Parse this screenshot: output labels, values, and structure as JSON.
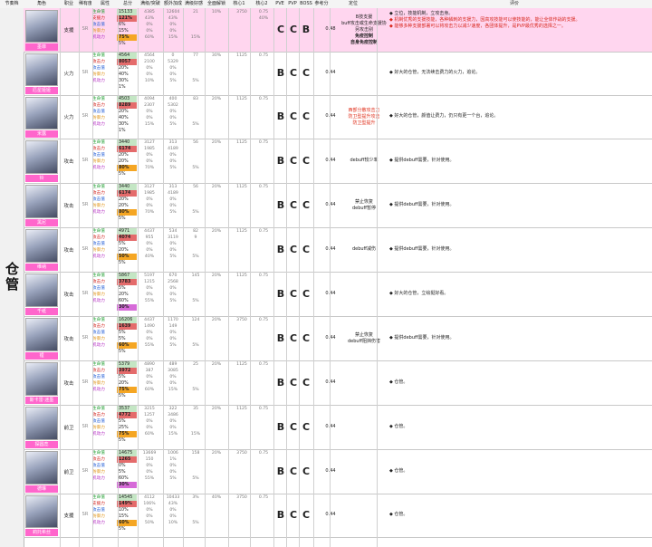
{
  "headers": [
    "节奏档",
    "角色",
    "职业",
    "稀有度",
    "属性",
    "总分",
    "满级/突破",
    "额外加成",
    "满级好感",
    "全面解锁",
    "核心1",
    "核心2",
    "PVE",
    "PVP",
    "BOSS",
    "参考分",
    "定位",
    "评价"
  ],
  "section_label": "仓管",
  "stat_labels": [
    [
      "生命值",
      "支援力",
      "攻击值",
      "防御力",
      "机动力"
    ],
    [
      "生命值",
      "攻击力",
      "攻击值",
      "防御力",
      "机动力"
    ],
    [
      "生命值",
      "攻击力",
      "攻击值",
      "防御力",
      "机动力"
    ],
    [
      "生命值",
      "攻击力",
      "攻击值",
      "防御力",
      "机动力"
    ],
    [
      "生命值",
      "攻击力",
      "攻击值",
      "防御力",
      "机动力"
    ],
    [
      "生命值",
      "攻击力",
      "攻击值",
      "防御力",
      "机动力"
    ],
    [
      "生命值",
      "攻击力",
      "攻击值",
      "防御力",
      "机动力"
    ],
    [
      "生命值",
      "攻击力",
      "攻击值",
      "防御力",
      "机动力"
    ],
    [
      "生命值",
      "攻击力",
      "攻击值",
      "防御力",
      "机动力"
    ],
    [
      "生命值",
      "攻击力",
      "攻击值",
      "防御力",
      "机动力"
    ],
    [
      "生命值",
      "攻击力",
      "攻击值",
      "防御力",
      "机动力"
    ],
    [
      "生命值",
      "支援力",
      "攻击值",
      "防御力",
      "机动力"
    ]
  ],
  "rows": [
    {
      "name": "墨菲",
      "role": "支援",
      "rarity": "SR",
      "totals": [
        "15133",
        "121%",
        "6%",
        "15%",
        "75%",
        "5%"
      ],
      "hl": 4,
      "c1": [
        "4385",
        "43%",
        "0%",
        "0%",
        "60%"
      ],
      "c2": [
        "12604",
        "43%",
        "0%",
        "0%",
        "15%"
      ],
      "c3": [
        "21",
        "",
        "",
        "",
        "15%"
      ],
      "c4": [
        "10%",
        "",
        "",
        "",
        ""
      ],
      "c5": [
        "3750",
        "",
        "",
        "",
        ""
      ],
      "c6": [
        "0.75",
        "40%",
        "",
        "",
        ""
      ],
      "pve": "C",
      "pvp": "C",
      "boss": "B",
      "ref": "0.48",
      "pos": [
        "B技支援",
        "buff攻击或生命支援协",
        "另攻击别",
        "免疫控制",
        "自身免疫控制"
      ],
      "pos_red": false,
      "eval": [
        "◆ 立位，技能机制，立攻击身。",
        "◆ 机制优秀的支援技能，各种鳞刺的支援力，因高攻技能可以使技能的，能让全体作战的支援。",
        "◆ 能够多种支援部署可以将攻击力以减少速度，各团体提升，是PVP最优秀的选择之一。"
      ],
      "pink": true
    },
    {
      "name": "厄星娅娅",
      "role": "火力",
      "rarity": "SR",
      "totals": [
        "4564",
        "8057",
        "20%",
        "40%",
        "30%",
        "1%"
      ],
      "hl": 1,
      "c1": [
        "4564",
        "2100",
        "0%",
        "0%",
        "10%"
      ],
      "c2": [
        "0",
        "5329",
        "0%",
        "0%",
        "5%"
      ],
      "c3": [
        "77",
        "",
        "",
        "",
        "5%"
      ],
      "c4": [
        "30%",
        "",
        "",
        "",
        ""
      ],
      "c5": [
        "1125",
        "",
        "",
        "",
        ""
      ],
      "c6": [
        "0.75",
        "",
        "",
        "",
        ""
      ],
      "pve": "B",
      "pvp": "C",
      "boss": "C",
      "ref": "0.44",
      "pos": [],
      "pos_red": false,
      "eval": [
        "◆ 好大的仓管，无法续击费力的火力，追论。"
      ],
      "pink": false
    },
    {
      "name": "米露",
      "role": "火力",
      "rarity": "SR",
      "totals": [
        "4503",
        "8289",
        "20%",
        "40%",
        "30%",
        "1%"
      ],
      "hl": 1,
      "c1": [
        "4094",
        "2307",
        "0%",
        "0%",
        "15%"
      ],
      "c2": [
        "400",
        "5302",
        "0%",
        "0%",
        "5%"
      ],
      "c3": [
        "83",
        "",
        "",
        "",
        "5%"
      ],
      "c4": [
        "20%",
        "",
        "",
        "",
        ""
      ],
      "c5": [
        "1125",
        "",
        "",
        "",
        ""
      ],
      "c6": [
        "0.75",
        "",
        "",
        "",
        ""
      ],
      "pve": "B",
      "pvp": "C",
      "boss": "C",
      "ref": "0.44",
      "pos": [
        "西部分散攻击力",
        "防卫型提升攻击",
        "防卫型提升"
      ],
      "pos_red": true,
      "eval": [
        "◆ 好大的仓管，颜值让费力，仍只有更一个台，追论。"
      ],
      "pink": false
    },
    {
      "name": "铃",
      "role": "攻击",
      "rarity": "SR",
      "totals": [
        "3440",
        "6174",
        "20%",
        "20%",
        "80%",
        "5%"
      ],
      "hl": 4,
      "c1": [
        "3127",
        "1985",
        "0%",
        "0%",
        "70%"
      ],
      "c2": [
        "313",
        "4189",
        "0%",
        "0%",
        "5%"
      ],
      "c3": [
        "56",
        "",
        "",
        "",
        "5%"
      ],
      "c4": [
        "20%",
        "",
        "",
        "",
        ""
      ],
      "c5": [
        "1125",
        "",
        "",
        "",
        ""
      ],
      "c6": [
        "0.75",
        "",
        "",
        "",
        ""
      ],
      "pve": "B",
      "pvp": "C",
      "boss": "C",
      "ref": "0.44",
      "pos": [
        "debuff较少率"
      ],
      "pos_red": false,
      "eval": [
        "◆ 提供debuff需要，针对使用。"
      ],
      "pink": false
    },
    {
      "name": "黑尼",
      "role": "攻击",
      "rarity": "SR",
      "totals": [
        "3440",
        "6174",
        "20%",
        "20%",
        "80%",
        "5%"
      ],
      "hl": 4,
      "c1": [
        "3127",
        "1985",
        "0%",
        "0%",
        "70%"
      ],
      "c2": [
        "313",
        "4189",
        "0%",
        "0%",
        "5%"
      ],
      "c3": [
        "56",
        "",
        "",
        "",
        "5%"
      ],
      "c4": [
        "20%",
        "",
        "",
        "",
        ""
      ],
      "c5": [
        "1125",
        "",
        "",
        "",
        ""
      ],
      "c6": [
        "0.75",
        "",
        "",
        "",
        ""
      ],
      "pve": "B",
      "pvp": "C",
      "boss": "C",
      "ref": "0.44",
      "pos": [
        "禁止恢复",
        "debuff暂停"
      ],
      "pos_red": false,
      "eval": [
        "◆ 提供debuff需要，针对使用。"
      ],
      "pink": false
    },
    {
      "name": "维纳",
      "role": "攻击",
      "rarity": "SR",
      "totals": [
        "4971",
        "4074",
        "5%",
        "20%",
        "50%",
        "5%"
      ],
      "hl": 4,
      "c1": [
        "4437",
        "955",
        "0%",
        "0%",
        "40%"
      ],
      "c2": [
        "534",
        "3119",
        "0%",
        "0%",
        "5%"
      ],
      "c3": [
        "82",
        "9",
        "",
        "",
        "5%"
      ],
      "c4": [
        "20%",
        "",
        "",
        "",
        ""
      ],
      "c5": [
        "1125",
        "",
        "",
        "",
        ""
      ],
      "c6": [
        "0.75",
        "",
        "",
        "",
        ""
      ],
      "pve": "B",
      "pvp": "C",
      "boss": "C",
      "ref": "0.44",
      "pos": [
        "debuff减伤"
      ],
      "pos_red": false,
      "eval": [
        "◆ 提供debuff需要，针对使用。"
      ],
      "pink": false
    },
    {
      "name": "千纸",
      "role": "攻击",
      "rarity": "SR",
      "totals": [
        "5867",
        "3783",
        "5%",
        "20%",
        "60%",
        "30%"
      ],
      "hl": 5,
      "c1": [
        "5197",
        "1215",
        "0%",
        "0%",
        "55%"
      ],
      "c2": [
        "670",
        "2568",
        "0%",
        "0%",
        "5%"
      ],
      "c3": [
        "145",
        "",
        "",
        "",
        "5%"
      ],
      "c4": [
        "20%",
        "",
        "",
        "",
        ""
      ],
      "c5": [
        "1125",
        "",
        "",
        "",
        ""
      ],
      "c6": [
        "0.75",
        "",
        "",
        "",
        ""
      ],
      "pve": "B",
      "pvp": "C",
      "boss": "C",
      "ref": "0.44",
      "pos": [],
      "pos_red": false,
      "eval": [
        "◆ 好大的仓管，立绘挺好看。"
      ],
      "pink": false
    },
    {
      "name": "锂",
      "role": "攻击",
      "rarity": "SR",
      "totals": [
        "16206",
        "1639",
        "5%",
        "5%",
        "60%",
        "5%"
      ],
      "hl": 4,
      "c1": [
        "4437",
        "1490",
        "0%",
        "0%",
        "55%"
      ],
      "c2": [
        "1170",
        "149",
        "0%",
        "0%",
        "5%"
      ],
      "c3": [
        "124",
        "",
        "",
        "",
        "5%"
      ],
      "c4": [
        "20%",
        "",
        "",
        "",
        ""
      ],
      "c5": [
        "3750",
        "",
        "",
        "",
        ""
      ],
      "c6": [
        "0.75",
        "",
        "",
        "",
        ""
      ],
      "pve": "B",
      "pvp": "C",
      "boss": "C",
      "ref": "0.44",
      "pos": [
        "禁止恢复",
        "debuff阻挡伤害"
      ],
      "pos_red": false,
      "eval": [
        "◆ 提供debuff需要，针对使用。"
      ],
      "pink": false
    },
    {
      "name": "斯卡雷·迷墨",
      "role": "攻击",
      "rarity": "SR",
      "totals": [
        "5379",
        "3972",
        "5%",
        "20%",
        "75%",
        "5%"
      ],
      "hl": 4,
      "c1": [
        "4890",
        "387",
        "0%",
        "0%",
        "60%"
      ],
      "c2": [
        "489",
        "3085",
        "0%",
        "0%",
        "15%"
      ],
      "c3": [
        "25",
        "",
        "",
        "",
        "5%"
      ],
      "c4": [
        "20%",
        "",
        "",
        "",
        ""
      ],
      "c5": [
        "1125",
        "",
        "",
        "",
        ""
      ],
      "c6": [
        "0.75",
        "",
        "",
        "",
        ""
      ],
      "pve": "B",
      "pvp": "C",
      "boss": "C",
      "ref": "0.44",
      "pos": [],
      "pos_red": false,
      "eval": [
        "◆ 仓管。"
      ],
      "pink": false
    },
    {
      "name": "探圆蕊",
      "role": "前卫",
      "rarity": "SR",
      "totals": [
        "3537",
        "4772",
        "5%",
        "25%",
        "75%",
        "5%"
      ],
      "hl": 4,
      "c1": [
        "3215",
        "1257",
        "0%",
        "0%",
        "60%"
      ],
      "c2": [
        "322",
        "3486",
        "0%",
        "0%",
        "15%"
      ],
      "c3": [
        "35",
        "",
        "",
        "",
        "15%"
      ],
      "c4": [
        "20%",
        "",
        "",
        "",
        ""
      ],
      "c5": [
        "1125",
        "",
        "",
        "",
        ""
      ],
      "c6": [
        "0.75",
        "",
        "",
        "",
        ""
      ],
      "pve": "B",
      "pvp": "C",
      "boss": "C",
      "ref": "0.44",
      "pos": [],
      "pos_red": false,
      "eval": [
        "◆ 仓管。"
      ],
      "pink": false
    },
    {
      "name": "德琳",
      "role": "前卫",
      "rarity": "SR",
      "totals": [
        "14675",
        "1265",
        "0%",
        "5%",
        "60%",
        "30%"
      ],
      "hl": 5,
      "c1": [
        "13669",
        "150",
        "0%",
        "0%",
        "55%"
      ],
      "c2": [
        "1006",
        "1%",
        "0%",
        "0%",
        "5%"
      ],
      "c3": [
        "158",
        "",
        "",
        "",
        "5%"
      ],
      "c4": [
        "20%",
        "",
        "",
        "",
        ""
      ],
      "c5": [
        "3750",
        "",
        "",
        "",
        ""
      ],
      "c6": [
        "0.75",
        "",
        "",
        "",
        ""
      ],
      "pve": "B",
      "pvp": "C",
      "boss": "C",
      "ref": "0.44",
      "pos": [],
      "pos_red": false,
      "eval": [
        "◆ 仓管。"
      ],
      "pink": false
    },
    {
      "name": "莉托希丝",
      "role": "支援",
      "rarity": "SR",
      "totals": [
        "14545",
        "149%",
        "10%",
        "15%",
        "60%",
        "5%"
      ],
      "hl": 4,
      "c1": [
        "4112",
        "106%",
        "0%",
        "0%",
        "50%"
      ],
      "c2": [
        "10433",
        "43%",
        "0%",
        "0%",
        "10%"
      ],
      "c3": [
        "3%",
        "",
        "",
        "",
        "5%"
      ],
      "c4": [
        "40%",
        "",
        "",
        "",
        ""
      ],
      "c5": [
        "3750",
        "",
        "",
        "",
        ""
      ],
      "c6": [
        "0.75",
        "",
        "",
        "",
        ""
      ],
      "pve": "B",
      "pvp": "C",
      "boss": "C",
      "ref": "0.44",
      "pos": [],
      "pos_red": false,
      "eval": [
        "◆ 仓管。"
      ],
      "pink": false
    }
  ]
}
